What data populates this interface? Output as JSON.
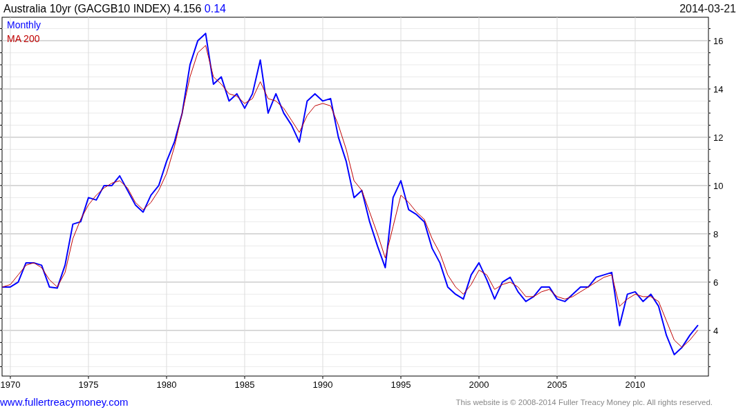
{
  "header": {
    "title": "Australia 10yr (GACGB10 INDEX) 4.156",
    "change": "0.14",
    "date": "2014-03-21"
  },
  "chart": {
    "chart_data": {
      "type": "line",
      "grid": true,
      "xlim": [
        1969.47,
        2014.69
      ],
      "ylim": [
        2.11,
        16.97
      ],
      "xticks": [
        1970,
        1975,
        1980,
        1985,
        1990,
        1995,
        2000,
        2005,
        2010
      ],
      "yticks": [
        4,
        6,
        8,
        10,
        12,
        14,
        16
      ],
      "x": [
        1969.5,
        1970,
        1970.5,
        1971,
        1971.5,
        1972,
        1972.5,
        1973,
        1973.5,
        1974,
        1974.5,
        1975,
        1975.5,
        1976,
        1976.5,
        1977,
        1977.5,
        1978,
        1978.5,
        1979,
        1979.5,
        1980,
        1980.5,
        1981,
        1981.5,
        1982,
        1982.5,
        1983,
        1983.5,
        1984,
        1984.5,
        1985,
        1985.5,
        1986,
        1986.5,
        1987,
        1987.5,
        1988,
        1988.5,
        1989,
        1989.5,
        1990,
        1990.5,
        1991,
        1991.5,
        1992,
        1992.5,
        1993,
        1993.5,
        1994,
        1994.5,
        1995,
        1995.5,
        1996,
        1996.5,
        1997,
        1997.5,
        1998,
        1998.5,
        1999,
        1999.5,
        2000,
        2000.5,
        2001,
        2001.5,
        2002,
        2002.5,
        2003,
        2003.5,
        2004,
        2004.5,
        2005,
        2005.5,
        2006,
        2006.5,
        2007,
        2007.5,
        2008,
        2008.5,
        2009,
        2009.5,
        2010,
        2010.5,
        2011,
        2011.5,
        2012,
        2012.5,
        2013,
        2013.5,
        2014
      ],
      "series": [
        {
          "name": "Monthly",
          "color": "#0000ff",
          "values": [
            5.8,
            5.8,
            6.0,
            6.8,
            6.8,
            6.7,
            5.8,
            5.75,
            6.7,
            8.4,
            8.5,
            9.5,
            9.4,
            10.0,
            10.0,
            10.4,
            9.8,
            9.2,
            8.9,
            9.6,
            10.0,
            11.0,
            11.8,
            13.0,
            15.0,
            16.0,
            16.3,
            14.2,
            14.5,
            13.5,
            13.8,
            13.2,
            13.8,
            15.2,
            13.0,
            13.8,
            13.0,
            12.5,
            11.8,
            13.5,
            13.8,
            13.5,
            13.6,
            12.0,
            11.0,
            9.5,
            9.8,
            8.5,
            7.5,
            6.6,
            9.5,
            10.2,
            9.0,
            8.8,
            8.5,
            7.4,
            6.8,
            5.8,
            5.5,
            5.3,
            6.3,
            6.8,
            6.1,
            5.3,
            6.0,
            6.2,
            5.6,
            5.2,
            5.4,
            5.8,
            5.8,
            5.3,
            5.2,
            5.5,
            5.8,
            5.8,
            6.2,
            6.3,
            6.4,
            4.2,
            5.5,
            5.6,
            5.2,
            5.5,
            5.0,
            3.8,
            3.0,
            3.3,
            3.8,
            4.2
          ]
        },
        {
          "name": "MA 200",
          "color": "#c00000",
          "values": [
            5.8,
            5.9,
            6.3,
            6.7,
            6.8,
            6.6,
            6.1,
            5.8,
            6.4,
            7.8,
            8.6,
            9.2,
            9.6,
            9.9,
            10.1,
            10.2,
            9.9,
            9.3,
            9.0,
            9.3,
            9.8,
            10.5,
            11.6,
            13.0,
            14.5,
            15.5,
            15.8,
            14.5,
            14.2,
            13.8,
            13.7,
            13.4,
            13.6,
            14.3,
            13.6,
            13.5,
            13.2,
            12.7,
            12.2,
            12.9,
            13.3,
            13.4,
            13.3,
            12.5,
            11.5,
            10.2,
            9.8,
            8.9,
            8.0,
            7.0,
            8.3,
            9.6,
            9.3,
            8.9,
            8.6,
            7.8,
            7.2,
            6.3,
            5.8,
            5.5,
            5.9,
            6.5,
            6.3,
            5.7,
            5.9,
            6.0,
            5.8,
            5.4,
            5.4,
            5.6,
            5.7,
            5.4,
            5.3,
            5.4,
            5.6,
            5.8,
            6.0,
            6.2,
            6.3,
            5.0,
            5.3,
            5.5,
            5.4,
            5.4,
            5.2,
            4.4,
            3.6,
            3.3,
            3.6,
            4.0
          ]
        }
      ]
    }
  },
  "footer": {
    "link": "www.fullertreacymoney.com",
    "copyright": "This website is © 2008-2014 Fuller Treacy Money plc. All rights reserved."
  }
}
